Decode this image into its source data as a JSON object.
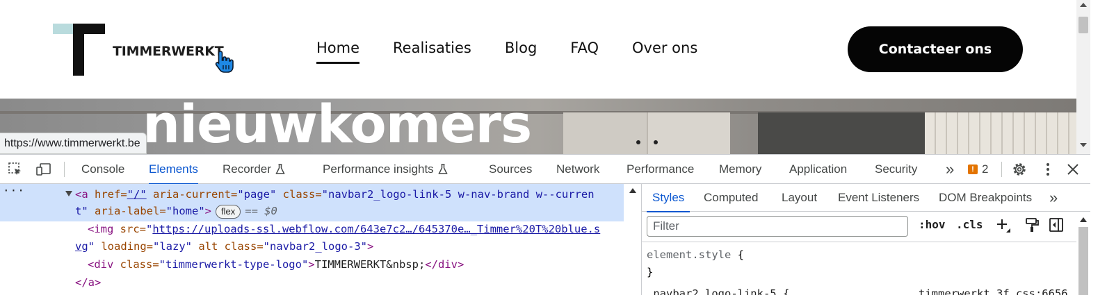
{
  "site": {
    "logo_text": "TIMMERWERKT",
    "nav": [
      {
        "label": "Home",
        "active": true
      },
      {
        "label": "Realisaties"
      },
      {
        "label": "Blog"
      },
      {
        "label": "FAQ"
      },
      {
        "label": "Over ons"
      }
    ],
    "cta_label": "Contacteer ons",
    "hero_title": "nieuwkomers",
    "status_url": "https://www.timmerwerkt.be",
    "colors": {
      "logo_accent": "#b9dbdd",
      "logo_black": "#111111",
      "cta_bg": "#050505"
    }
  },
  "devtools": {
    "tabs": [
      {
        "label": "Console"
      },
      {
        "label": "Elements",
        "active": true
      },
      {
        "label": "Recorder",
        "experimental": true
      },
      {
        "label": "Performance insights",
        "experimental": true
      },
      {
        "label": "Sources"
      },
      {
        "label": "Network"
      },
      {
        "label": "Performance"
      },
      {
        "label": "Memory"
      },
      {
        "label": "Application"
      },
      {
        "label": "Security"
      }
    ],
    "overflow_label": "»",
    "issues_count": "2",
    "elements": {
      "line1": {
        "tag_open": "<a",
        "href_attr": " href=",
        "href_val": "\"/\"",
        "aria_current_attr": " aria-current=",
        "aria_current_val": "\"page\"",
        "class_attr": " class=",
        "class_val_1": "\"navbar2_logo-link-5 w-nav-brand w--curren",
        "class_val_2": "t\"",
        "aria_label_attr": " aria-label=",
        "aria_label_val": "\"home\"",
        "tag_close": ">",
        "badge": "flex",
        "dollar": "== $0"
      },
      "line2": {
        "tag_open": "<img",
        "src_attr": " src=",
        "src_q": "\"",
        "src_link_1": "https://uploads-ssl.webflow.com/643e7c2…/645370e…_Timmer%20T%20blue.s",
        "src_link_2": "vg",
        "src_q_end": "\"",
        "loading_attr": " loading=",
        "loading_val": "\"lazy\"",
        "alt_attr": " alt",
        "class_attr": " class=",
        "class_val": "\"navbar2_logo-3\"",
        "tag_close": ">"
      },
      "line3": {
        "tag_open": "<div",
        "class_attr": " class=",
        "class_val": "\"timmerwerkt-type-logo\"",
        "tag_mid": ">",
        "text": "TIMMERWERKT&nbsp;",
        "tag_end": "</div>"
      },
      "line4": {
        "tag_end": "</a>"
      },
      "more": "···"
    },
    "styles": {
      "tabs": [
        {
          "label": "Styles",
          "active": true
        },
        {
          "label": "Computed"
        },
        {
          "label": "Layout"
        },
        {
          "label": "Event Listeners"
        },
        {
          "label": "DOM Breakpoints"
        }
      ],
      "filter_placeholder": "Filter",
      "hov": ":hov",
      "cls": ".cls",
      "element_style": "element.style",
      "brace_open": " {",
      "brace_close": "}",
      "rule_selector": ".navbar2_logo-link-5",
      "rule_source": "timmerwerkt…3f.css:6656"
    }
  }
}
